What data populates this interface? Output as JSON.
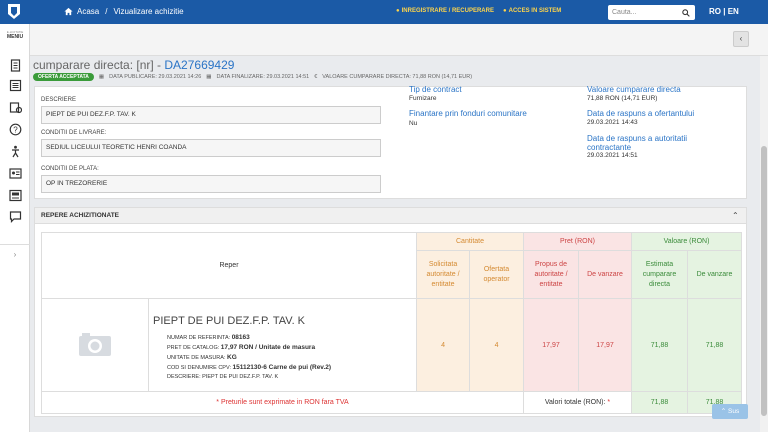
{
  "topbar": {
    "breadcrumb_home": "Acasa",
    "breadcrumb_sep": "/",
    "breadcrumb_current": "Vizualizare achizitie",
    "register_link": "INREGISTRARE / RECUPERARE",
    "login_link": "ACCES IN SISTEM",
    "search_placeholder": "Cauta...",
    "lang_ro": "RO",
    "lang_sep": "|",
    "lang_en": "EN"
  },
  "sidebar": {
    "menu_small": "E-LICITATIE",
    "menu_label": "MENIU",
    "icons": [
      "document-icon",
      "list-icon",
      "notification-icon",
      "help-icon",
      "accessibility-icon",
      "contact-card-icon",
      "catalog-icon",
      "chat-icon"
    ],
    "expand_glyph": "›"
  },
  "header": {
    "back_glyph": "‹",
    "title_prefix": "cumparare directa: [nr] - ",
    "title_code": "DA27669429",
    "status_badge": "OFERTA ACCEPTATA",
    "data_publicare": "DATA PUBLICARE: 29.03.2021 14:26",
    "data_finalizare": "DATA FINALIZARE: 29.03.2021 14:51",
    "valoare": "VALOARE CUMPARARE DIRECTA: 71,88  RON (14,71  EUR)"
  },
  "details": {
    "descriere_label": "DESCRIERE",
    "descriere_value": "PIEPT DE PUI DEZ.F.P. TAV. K",
    "livrare_label": "CONDITII DE LIVRARE:",
    "livrare_value": "SEDIUL LICEULUI TEORETIC HENRI COANDA",
    "plata_label": "CONDITII DE PLATA:",
    "plata_value": "OP IN TREZORERIE",
    "tip_contract_label": "Tip de contract",
    "tip_contract_value": "Furnizare",
    "fonduri_label": "Finantare prin fonduri comunitare",
    "fonduri_value": "Nu",
    "valoare_label": "Valoare cumparare directa",
    "valoare_value": "71,88  RON (14,71  EUR)",
    "raspuns_ofertant_label": "Data de raspuns a ofertantului",
    "raspuns_ofertant_value": "29.03.2021 14:43",
    "raspuns_autoritate_label_1": "Data de raspuns a autoritatii",
    "raspuns_autoritate_label_2": "contractante",
    "raspuns_autoritate_value": "29.03.2021 14:51"
  },
  "repere": {
    "section_title": "REPERE ACHIZITIONATE",
    "collapse_glyph": "⌃",
    "col_reper": "Reper",
    "group_cantitate": "Cantitate",
    "group_pret": "Pret (RON)",
    "group_valoare": "Valoare (RON)",
    "sub_solicitata": "Solicitata autoritate / entitate",
    "sub_ofertata": "Ofertata operator",
    "sub_propus": "Propus de autoritate / entitate",
    "sub_vanzare_pret": "De vanzare",
    "sub_estimata": "Estimata cumparare directa",
    "sub_vanzare_val": "De vanzare",
    "item": {
      "name": "PIEPT DE PUI DEZ.F.P. TAV. K",
      "ref_label": "NUMAR DE REFERINTA:",
      "ref_value": "08163",
      "pret_catalog_label": "PRET DE CATALOG:",
      "pret_catalog_value": "17,97  RON / Unitate de masura",
      "um_label": "UNITATE DE MASURA:",
      "um_value": "KG",
      "cpv_label": "COD SI DENUMIRE CPV:",
      "cpv_value": "15112130-6 Carne de pui (Rev.2)",
      "descriere_label": "DESCRIERE:",
      "descriere_value": "PIEPT DE PUI DEZ.F.P. TAV. K",
      "cant_solicitata": "4",
      "cant_ofertata": "4",
      "pret_propus": "17,97",
      "pret_vanzare": "17,97",
      "val_estimata": "71,88",
      "val_vanzare": "71,88"
    },
    "note": "* Preturile sunt exprimate in RON fara TVA",
    "total_label": "Valori totale (RON):",
    "total_star": "*",
    "total_estimata": "71,88",
    "total_vanzare": "71,88"
  },
  "sus_button": "Sus"
}
